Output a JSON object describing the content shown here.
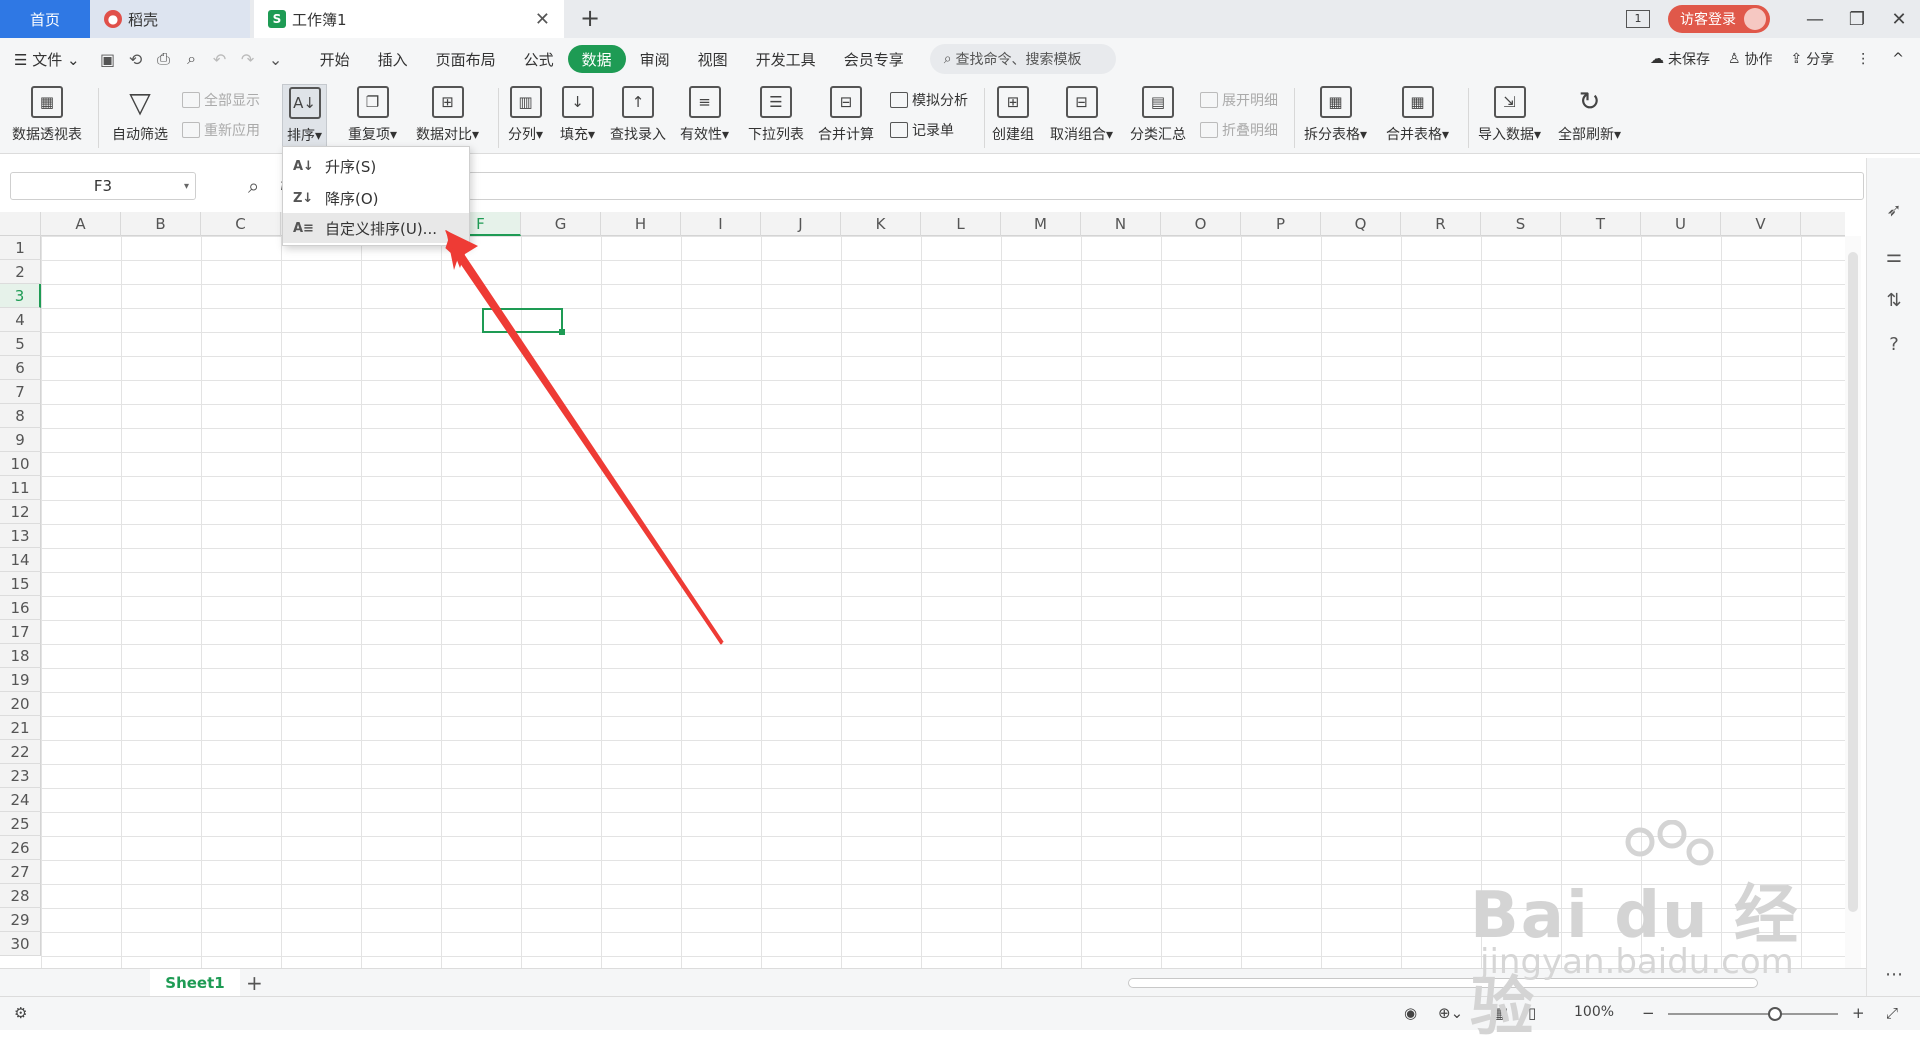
{
  "tabs": {
    "home": "首页",
    "docer": "稻壳",
    "workbook": "工作簿1",
    "workbook_badge": "S",
    "close": "✕",
    "new_tab": "+"
  },
  "window": {
    "page_count": "1",
    "login": "访客登录",
    "minimize": "—",
    "restore": "❐",
    "close": "✕"
  },
  "menubar": {
    "file": "☰ 文件 ⌄",
    "items": [
      "开始",
      "插入",
      "页面布局",
      "公式",
      "数据",
      "审阅",
      "视图",
      "开发工具",
      "会员专享"
    ],
    "active": "数据",
    "search_placeholder": "查找命令、搜索模板",
    "unsaved": "未保存",
    "collab": "协作",
    "share": "分享",
    "more": "⋮",
    "collapse": "^"
  },
  "ribbon": {
    "pivot": "数据透视表",
    "autofilter": "自动筛选",
    "showall": "全部显示",
    "reapply": "重新应用",
    "sort": "排序",
    "duplicates": "重复项",
    "compare": "数据对比",
    "split": "分列",
    "fill": "填充",
    "lookup": "查找录入",
    "validity": "有效性",
    "droplist": "下拉列表",
    "consolidate": "合并计算",
    "simulate": "模拟分析",
    "record": "记录单",
    "group": "创建组",
    "ungroup": "取消组合",
    "subtotal": "分类汇总",
    "expand": "展开明细",
    "collapse": "折叠明细",
    "splittable": "拆分表格",
    "mergetable": "合并表格",
    "import": "导入数据",
    "refresh": "全部刷新"
  },
  "formula": {
    "cell": "F3",
    "fx_icon": "fx"
  },
  "grid": {
    "columns": [
      "A",
      "B",
      "C",
      "D",
      "E",
      "F",
      "G",
      "H",
      "I",
      "J",
      "K",
      "L",
      "M",
      "N",
      "O",
      "P",
      "Q",
      "R",
      "S",
      "T",
      "U",
      "V"
    ],
    "rows": [
      "1",
      "2",
      "3",
      "4",
      "5",
      "6",
      "7",
      "8",
      "9",
      "10",
      "11",
      "12",
      "13",
      "14",
      "15",
      "16",
      "17",
      "18",
      "19",
      "20",
      "21",
      "22",
      "23",
      "24",
      "25",
      "26",
      "27",
      "28",
      "29",
      "30"
    ],
    "selected_col": "F",
    "selected_row": "3"
  },
  "dropdown": {
    "ascending": "升序(S)",
    "descending": "降序(O)",
    "custom": "自定义排序(U)..."
  },
  "sheets": {
    "tab": "Sheet1",
    "add": "+"
  },
  "status": {
    "zoom": "100%",
    "minus": "−",
    "plus": "+"
  },
  "watermark": {
    "main": "Bai du 经验",
    "sub": "jingyan.baidu.com"
  },
  "colors": {
    "accent": "#1e9b54",
    "home_tab": "#2f78e4",
    "login": "#e0584a",
    "arrow": "#ee3b35"
  }
}
